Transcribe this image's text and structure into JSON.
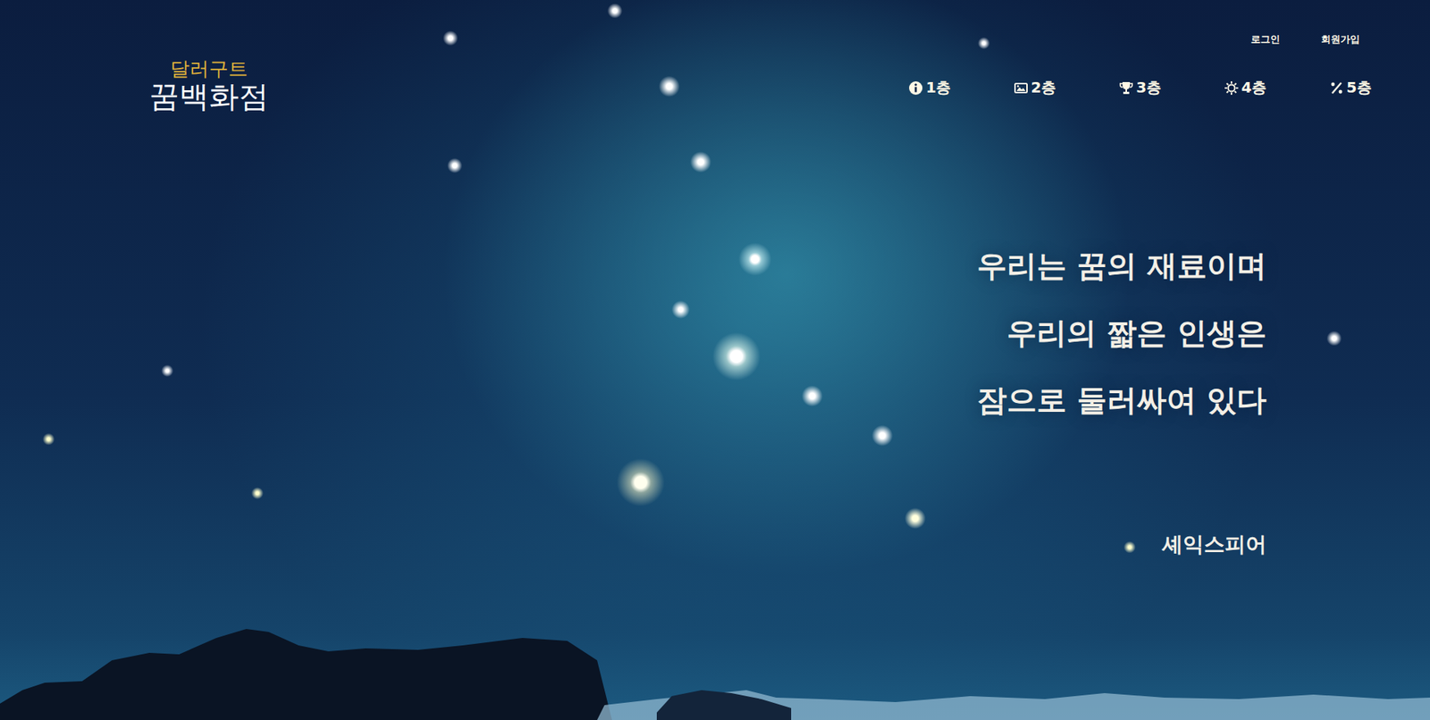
{
  "logo": {
    "top": "달러구트",
    "bottom": "꿈백화점"
  },
  "account_links": [
    "로그인",
    "회원가입"
  ],
  "nav": [
    {
      "label": "1층"
    },
    {
      "label": "2층"
    },
    {
      "label": "3층"
    },
    {
      "label": "4층"
    },
    {
      "label": "5층"
    }
  ],
  "quote": {
    "lines": [
      "우리는 꿈의 재료이며",
      "우리의 짧은 인생은",
      "잠으로 둘러싸여 있다"
    ],
    "author": "셰익스피어"
  }
}
